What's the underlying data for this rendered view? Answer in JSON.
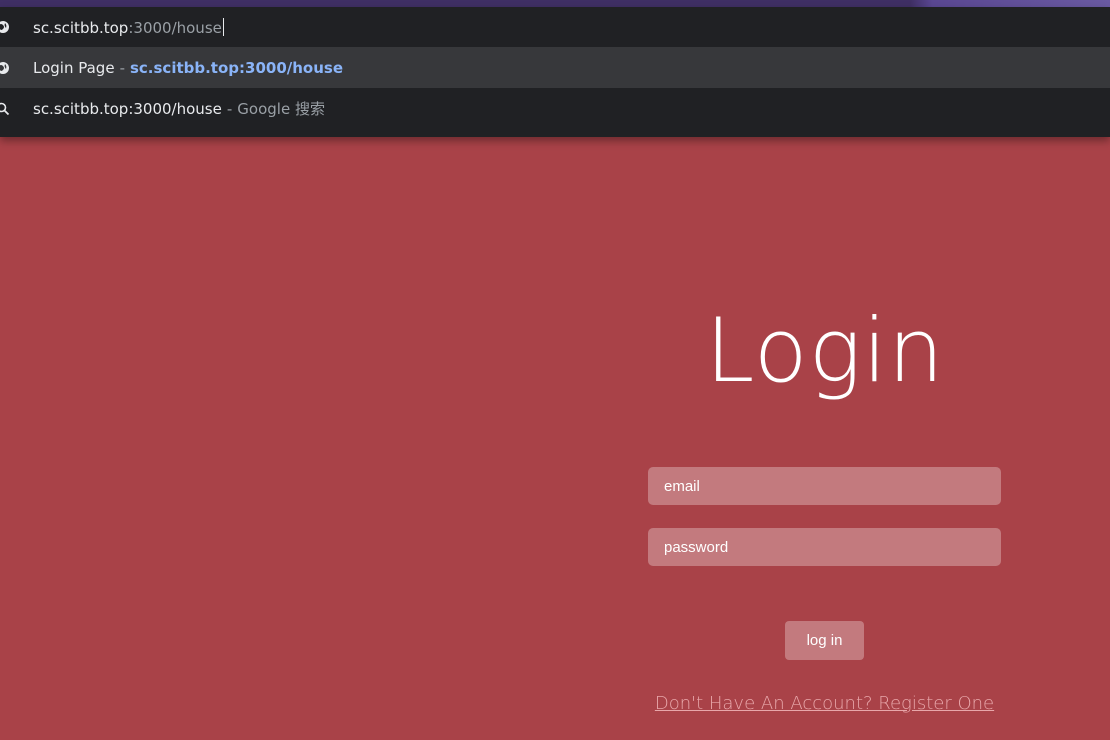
{
  "browser": {
    "omnibox": {
      "input": {
        "host": "sc.scitbb.top",
        "path": ":3000/house"
      },
      "suggestions": [
        {
          "icon": "globe-icon",
          "title": "Login Page",
          "separator": "-",
          "url": "sc.scitbb.top:3000/house"
        },
        {
          "icon": "search-icon",
          "query": "sc.scitbb.top:3000/house",
          "separator": "-",
          "engine": "Google 搜索"
        }
      ]
    }
  },
  "page": {
    "title": "Login",
    "email_placeholder": "email",
    "password_placeholder": "password",
    "login_button": "log in",
    "register_link": "Don't Have An Account? Register One"
  },
  "colors": {
    "page_background": "#a94248",
    "field_background": "#c37a7e",
    "link_color": "#e8a7aa",
    "omnibox_background": "#202124",
    "omnibox_selected": "#37383b",
    "url_accent": "#8ab4f8"
  }
}
